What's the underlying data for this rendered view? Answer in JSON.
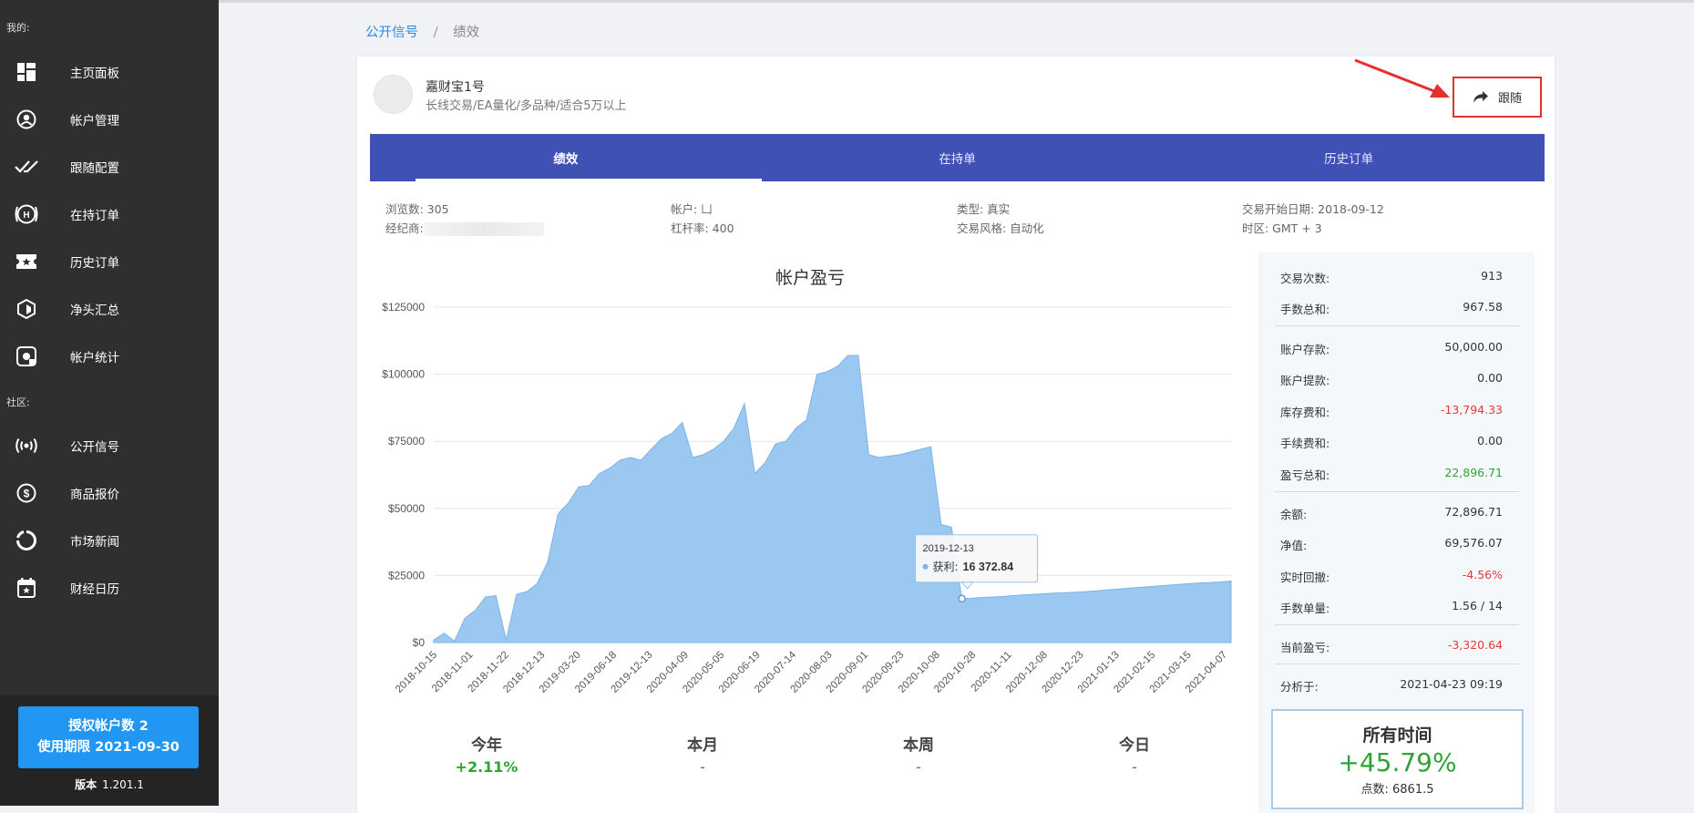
{
  "sidebar": {
    "section_mine": "我的:",
    "section_community": "社区:",
    "items": [
      {
        "label": "主页面板",
        "icon": "dashboard-icon"
      },
      {
        "label": "帐户管理",
        "icon": "user-circle-icon"
      },
      {
        "label": "跟随配置",
        "icon": "double-check-icon"
      },
      {
        "label": "在持订单",
        "icon": "holdings-icon"
      },
      {
        "label": "历史订单",
        "icon": "ticket-icon"
      },
      {
        "label": "净头汇总",
        "icon": "cube-icon"
      },
      {
        "label": "帐户统计",
        "icon": "stats-icon"
      },
      {
        "label": "公开信号",
        "icon": "broadcast-icon"
      },
      {
        "label": "商品报价",
        "icon": "dollar-icon"
      },
      {
        "label": "市场新闻",
        "icon": "news-ring-icon"
      },
      {
        "label": "财经日历",
        "icon": "calendar-icon"
      }
    ],
    "license_line1": "授权帐户数 2",
    "license_line2": "使用期限 2021-09-30",
    "version_label": "版本",
    "version_value": "1.201.1"
  },
  "breadcrumb": {
    "parent": "公开信号",
    "separator": "/",
    "current": "绩效"
  },
  "account": {
    "name": "嘉财宝1号",
    "description": "长线交易/EA量化/多品种/适合5万以上"
  },
  "follow_label": "跟随",
  "tabs": [
    "绩效",
    "在持单",
    "历史订单"
  ],
  "info": {
    "views": "浏览数: 305",
    "broker": "经纪商:",
    "account": "帐户: 凵",
    "leverage": "杠杆率: 400",
    "type": "类型: 真实",
    "style": "交易风格: 自动化",
    "start_date": "交易开始日期: 2018-09-12",
    "timezone": "时区: GMT + 3"
  },
  "chart_data": {
    "type": "area",
    "title": "帐户盈亏",
    "xlabel": "",
    "ylabel": "",
    "ylim": [
      0,
      125000
    ],
    "yticks": [
      "$0",
      "$25000",
      "$50000",
      "$75000",
      "$100000",
      "$125000"
    ],
    "x_tick_labels": [
      "2018-10-15",
      "2018-11-01",
      "2018-11-22",
      "2018-12-13",
      "2019-03-20",
      "2019-06-18",
      "2019-12-13",
      "2020-04-09",
      "2020-05-05",
      "2020-06-19",
      "2020-07-14",
      "2020-08-03",
      "2020-09-01",
      "2020-09-23",
      "2020-10-08",
      "2020-10-28",
      "2020-11-11",
      "2020-12-08",
      "2020-12-23",
      "2021-01-13",
      "2021-02-15",
      "2021-03-15",
      "2021-04-07"
    ],
    "color": "#90c2f0",
    "series": [
      {
        "values": [
          1000,
          3500,
          500,
          9000,
          12000,
          17000,
          17500,
          1000,
          18000,
          19000,
          22000,
          30000,
          48000,
          52000,
          58000,
          58500,
          63000,
          65000,
          68000,
          69000,
          68000,
          72000,
          76000,
          78000,
          82000,
          69000,
          70000,
          72000,
          75000,
          80000,
          89000,
          63000,
          67000,
          74000,
          75000,
          80000,
          83000,
          100000,
          101000,
          103000,
          107000,
          107000,
          70000,
          69000,
          69500,
          70000,
          71000,
          72000,
          73000,
          44000,
          43000,
          16372.84,
          16500,
          16800,
          17000,
          17200,
          17500,
          17800,
          18000,
          18200,
          18400,
          18600,
          18800,
          19000,
          19300,
          19600,
          19900,
          20200,
          20500,
          20800,
          21100,
          21400,
          21700,
          22000,
          22200,
          22400,
          22600,
          22896.71
        ]
      }
    ],
    "tooltip": {
      "date": "2019-12-13",
      "label": "获利:",
      "value": "16 372.84"
    },
    "grid": true,
    "legend": "none"
  },
  "periods": [
    {
      "label": "今年",
      "value": "+2.11%",
      "positive": true
    },
    {
      "label": "本月",
      "value": "-",
      "positive": false
    },
    {
      "label": "本周",
      "value": "-",
      "positive": false
    },
    {
      "label": "今日",
      "value": "-",
      "positive": false
    }
  ],
  "stats": [
    {
      "label": "交易次数:",
      "value": "913",
      "tone": ""
    },
    {
      "label": "手数总和:",
      "value": "967.58",
      "tone": ""
    },
    {
      "label": "账户存款:",
      "value": "50,000.00",
      "tone": ""
    },
    {
      "label": "账户提款:",
      "value": "0.00",
      "tone": ""
    },
    {
      "label": "库存费和:",
      "value": "-13,794.33",
      "tone": "neg"
    },
    {
      "label": "手续费和:",
      "value": "0.00",
      "tone": ""
    },
    {
      "label": "盈亏总和:",
      "value": "22,896.71",
      "tone": "pos"
    },
    {
      "label": "余额:",
      "value": "72,896.71",
      "tone": ""
    },
    {
      "label": "净值:",
      "value": "69,576.07",
      "tone": ""
    },
    {
      "label": "实时回撤:",
      "value": "-4.56%",
      "tone": "neg"
    },
    {
      "label": "手数单量:",
      "value": "1.56 / 14",
      "tone": ""
    },
    {
      "label": "当前盈亏:",
      "value": "-3,320.64",
      "tone": "neg"
    },
    {
      "label": "分析于:",
      "value": "2021-04-23 09:19",
      "tone": ""
    }
  ],
  "all_time": {
    "title": "所有时间",
    "value": "+45.79%",
    "points": "点数: 6861.5"
  }
}
